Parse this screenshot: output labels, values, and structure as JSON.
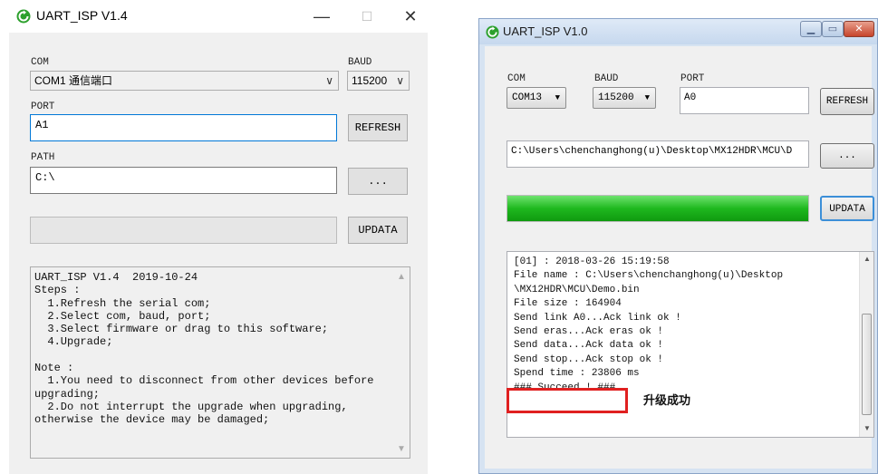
{
  "left_window": {
    "title": "UART_ISP V1.4",
    "controls": {
      "minimize": "—",
      "maximize": "☐",
      "close": "✕"
    },
    "com": {
      "label": "COM",
      "value": "COM1 通信端口"
    },
    "baud": {
      "label": "BAUD",
      "value": "115200"
    },
    "port": {
      "label": "PORT",
      "value": "A1"
    },
    "refresh_label": "REFRESH",
    "path": {
      "label": "PATH",
      "value": "C:\\"
    },
    "browse_label": "...",
    "updata_label": "UPDATA",
    "log_text": "UART_ISP V1.4  2019-10-24\nSteps :\n  1.Refresh the serial com;\n  2.Select com, baud, port;\n  3.Select firmware or drag to this software;\n  4.Upgrade;\n\nNote :\n  1.You need to disconnect from other devices before\nupgrading;\n  2.Do not interrupt the upgrade when upgrading,\notherwise the device may be damaged;"
  },
  "right_window": {
    "title": "UART_ISP V1.0",
    "controls": {
      "minimize": "▁",
      "maximize": "▭",
      "close": "✕"
    },
    "com": {
      "label": "COM",
      "value": "COM13"
    },
    "baud": {
      "label": "BAUD",
      "value": "115200"
    },
    "port": {
      "label": "PORT",
      "value": "A0"
    },
    "refresh_label": "REFRESH",
    "path_value": "C:\\Users\\chenchanghong(u)\\Desktop\\MX12HDR\\MCU\\D",
    "browse_label": "...",
    "updata_label": "UPDATA",
    "progress": 1.0,
    "progress_color": "#1fb81f",
    "log_text": "[01] : 2018-03-26 15:19:58\nFile name : C:\\Users\\chenchanghong(u)\\Desktop\n\\MX12HDR\\MCU\\Demo.bin\nFile size : 164904\nSend link A0...Ack link ok !\nSend eras...Ack eras ok !\nSend data...Ack data ok !\nSend stop...Ack stop ok !\nSpend time : 23806 ms\n### Succeed ! ###",
    "success_annotation": "升级成功",
    "highlight_color": "#e02020"
  }
}
